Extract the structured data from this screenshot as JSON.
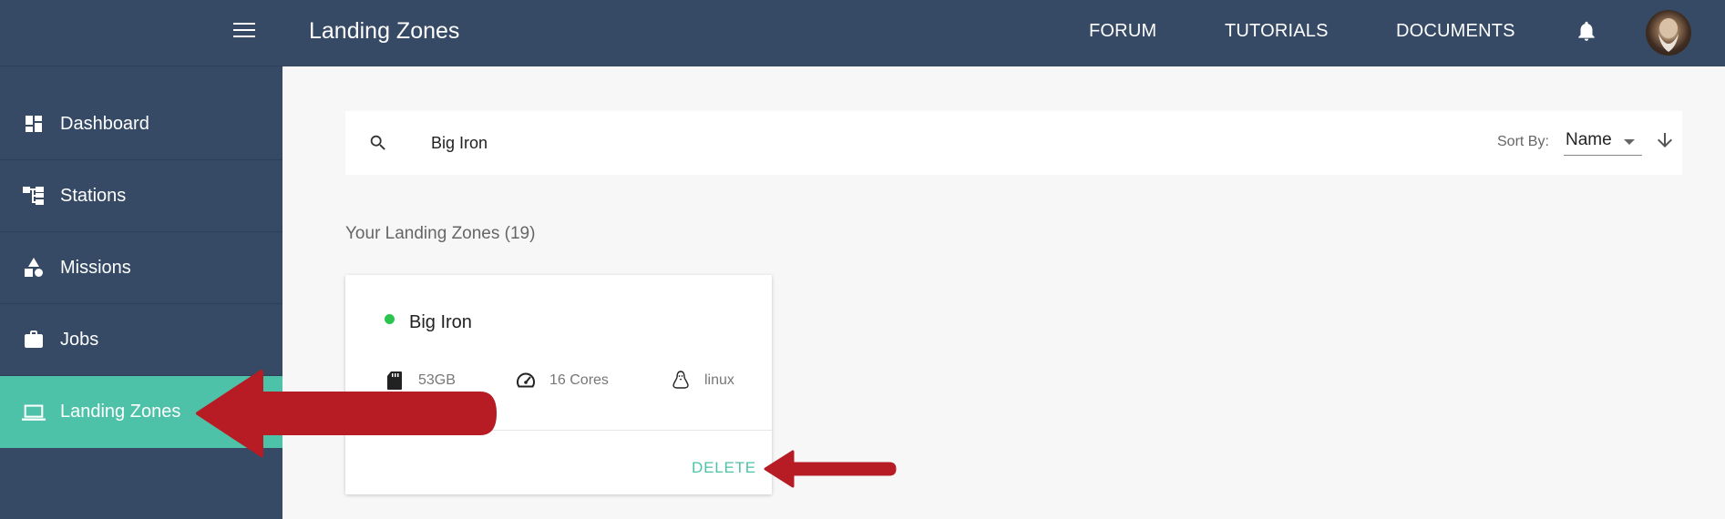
{
  "header": {
    "page_title": "Landing Zones",
    "nav": [
      "FORUM",
      "TUTORIALS",
      "DOCUMENTS"
    ]
  },
  "sidebar": {
    "items": [
      {
        "label": "Dashboard",
        "icon": "dashboard-icon"
      },
      {
        "label": "Stations",
        "icon": "stations-icon"
      },
      {
        "label": "Missions",
        "icon": "missions-icon"
      },
      {
        "label": "Jobs",
        "icon": "briefcase-icon"
      },
      {
        "label": "Landing Zones",
        "icon": "laptop-icon",
        "active": true
      }
    ]
  },
  "search": {
    "value": "Big Iron",
    "sort_label": "Sort By:",
    "sort_value": "Name"
  },
  "section_title": "Your Landing Zones (19)",
  "card": {
    "title": "Big Iron",
    "status_color": "#2bc44f",
    "storage": "53GB",
    "cores": "16 Cores",
    "os": "linux",
    "delete_label": "DELETE"
  },
  "colors": {
    "primary": "#364a65",
    "accent": "#4ec2a8",
    "annotation": "#b71c24"
  }
}
